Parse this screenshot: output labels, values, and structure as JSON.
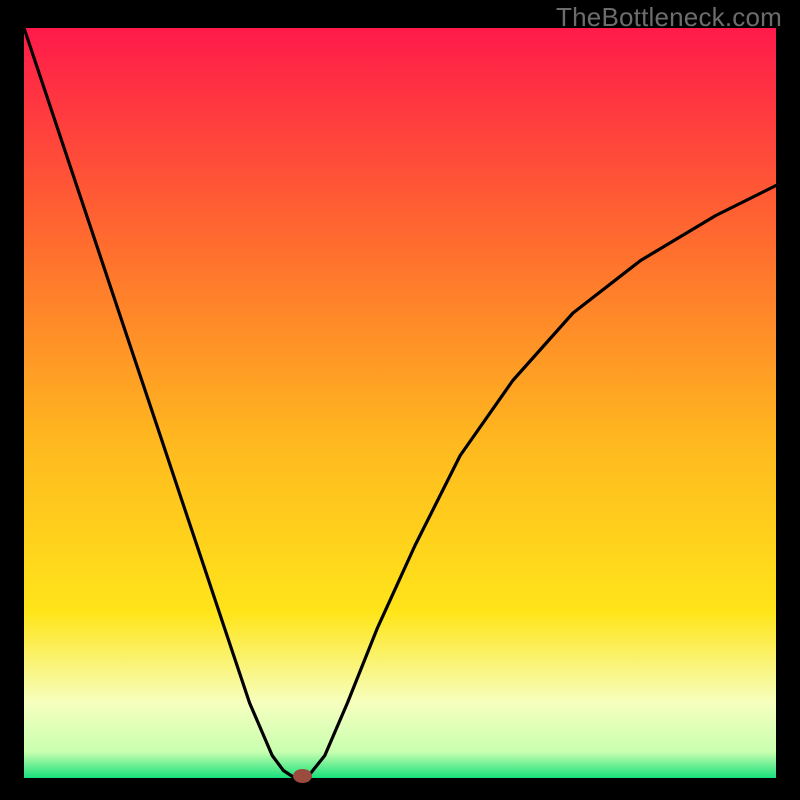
{
  "watermark": "TheBottleneck.com",
  "colors": {
    "gradient_top": "#ff1a4a",
    "gradient_mid1": "#ff8a2a",
    "gradient_mid2": "#ffe51a",
    "gradient_pale": "#f6ffbf",
    "gradient_bottom": "#17e07b",
    "curve": "#000000",
    "marker": "#9b4a3e",
    "frame_bg": "#000000"
  },
  "chart_data": {
    "type": "line",
    "title": "",
    "xlabel": "",
    "ylabel": "",
    "xlim": [
      0,
      100
    ],
    "ylim": [
      0,
      100
    ],
    "series": [
      {
        "name": "bottleneck-curve",
        "x": [
          0,
          3,
          6,
          9,
          12,
          15,
          18,
          21,
          24,
          27,
          30,
          33,
          34.5,
          36,
          37,
          38,
          40,
          43,
          47,
          52,
          58,
          65,
          73,
          82,
          92,
          100
        ],
        "y": [
          100,
          91,
          82,
          73,
          64,
          55,
          46,
          37,
          28,
          19,
          10,
          3,
          1,
          0,
          0,
          0.5,
          3,
          10,
          20,
          31,
          43,
          53,
          62,
          69,
          75,
          79
        ]
      }
    ],
    "marker": {
      "x": 37,
      "y": 0,
      "label": "optimal-point"
    },
    "grid": false,
    "legend": false
  }
}
